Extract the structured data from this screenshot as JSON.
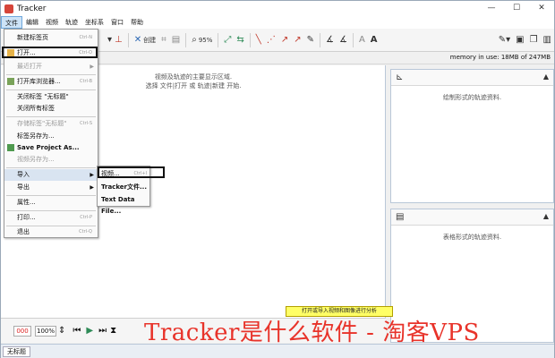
{
  "window": {
    "title": "Tracker",
    "min": "—",
    "max": "☐",
    "close": "✕"
  },
  "menubar": [
    "文件",
    "编辑",
    "视频",
    "轨迹",
    "坐标系",
    "窗口",
    "帮助"
  ],
  "toolbar": {
    "create_label": "创建",
    "zoom_label": "95%"
  },
  "memory": "memory in use: 18MB of 247MB",
  "video_hint": [
    "视频及轨迹的主要显示区域.",
    "选择 文件|打开 或 轨迹|新建 开始."
  ],
  "yellow_hint": "打开或导入视频和图像进行分析",
  "panel_top": {
    "message": "绘制形式的轨迹资料."
  },
  "panel_bottom": {
    "message": "表格形式的轨迹资料."
  },
  "bottom": {
    "frame": "000",
    "zoom": "100%"
  },
  "status_tab": "无标题",
  "watermark": "Tracker是什么软件 - 淘客VPS",
  "file_menu": {
    "new_tab": {
      "label": "新建标签页",
      "shortcut": "Ctrl-N"
    },
    "open": {
      "label": "打开...",
      "shortcut": "Ctrl-O"
    },
    "recent": {
      "label": "最近打开"
    },
    "open_browser": {
      "label": "打开库浏览器...",
      "shortcut": "Ctrl-B"
    },
    "close_tab": {
      "label": "关闭标签 \"无标题\""
    },
    "close_all": {
      "label": "关闭所有标签"
    },
    "save_tab": {
      "label": "存储标签\"无标题\"",
      "shortcut": "Ctrl-S"
    },
    "save_tab_as": {
      "label": "标签另存为..."
    },
    "save_project_as": {
      "label": "Save Project As..."
    },
    "save_video_as": {
      "label": "视频另存为..."
    },
    "import": {
      "label": "导入"
    },
    "export": {
      "label": "导出"
    },
    "properties": {
      "label": "属性..."
    },
    "print": {
      "label": "打印...",
      "shortcut": "Ctrl-P"
    },
    "exit": {
      "label": "退出",
      "shortcut": "Ctrl-Q"
    }
  },
  "import_submenu": {
    "video": {
      "label": "视频...",
      "shortcut": "Ctrl+I"
    },
    "tracker_file": {
      "label": "Tracker文件..."
    },
    "text_data": {
      "label": "Text Data File..."
    }
  }
}
